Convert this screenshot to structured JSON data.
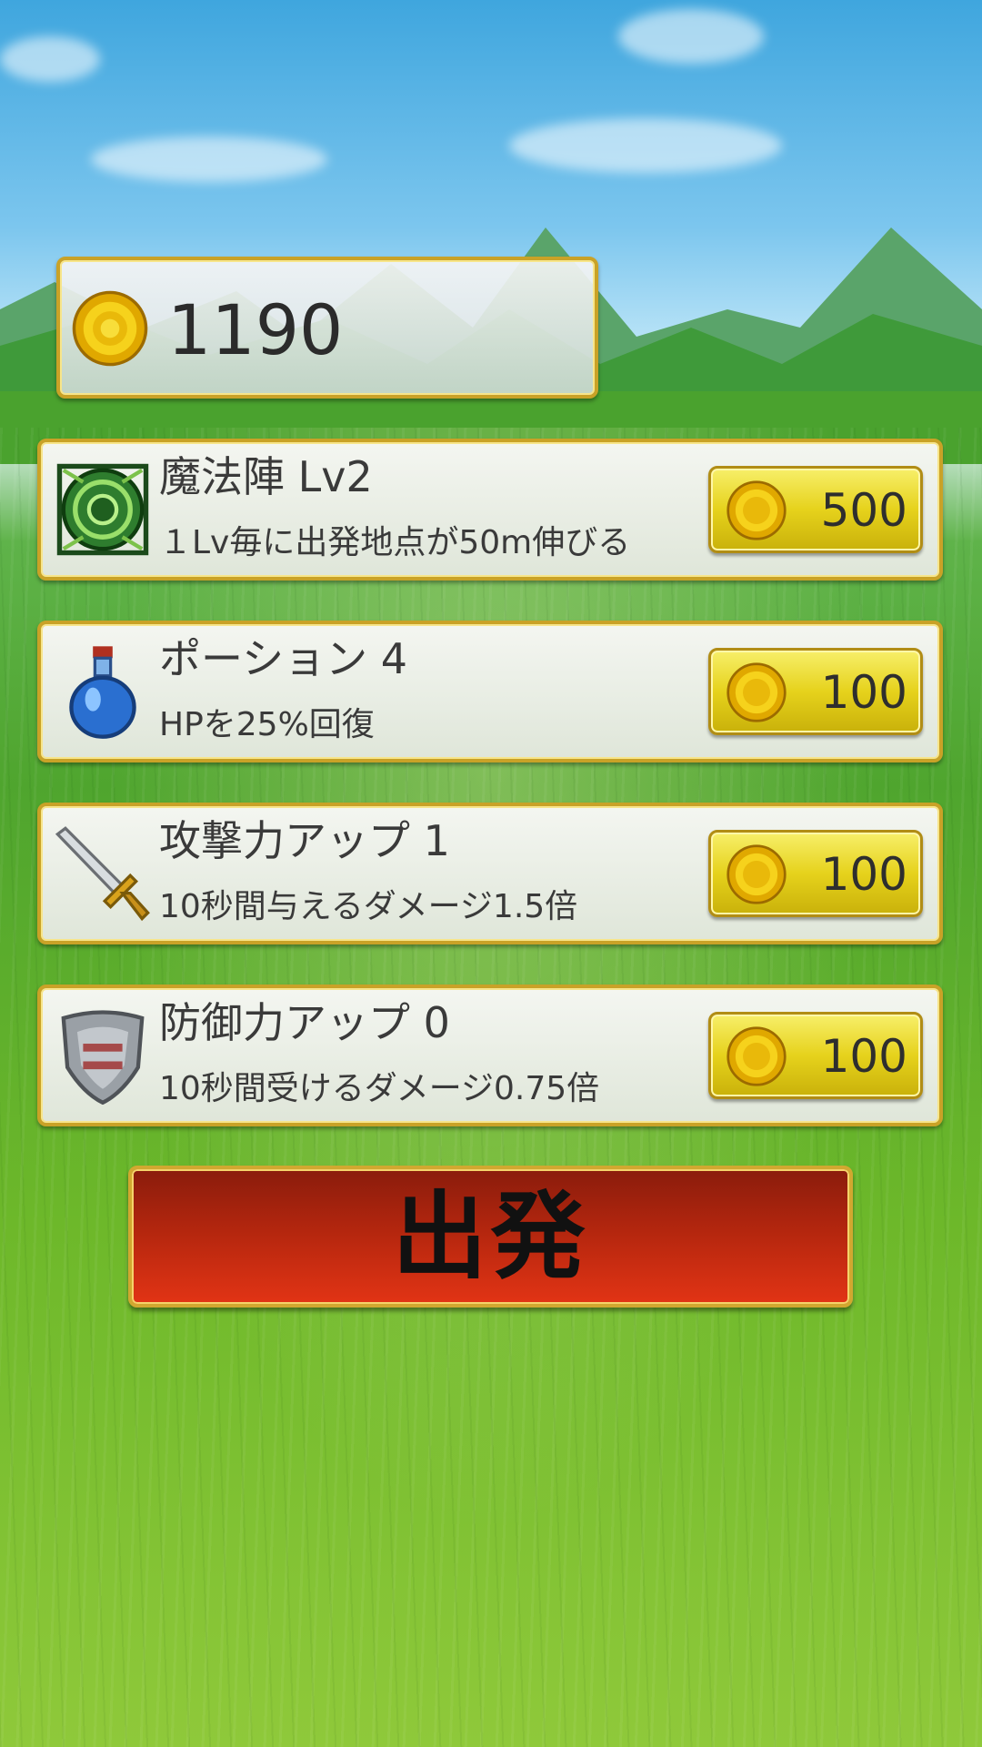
{
  "wallet": {
    "coins": "1190"
  },
  "items": [
    {
      "name": "魔法陣 Lv2",
      "desc": "１Lv毎に出発地点が50m伸びる",
      "price": "500",
      "icon": "magic-circle-icon"
    },
    {
      "name": "ポーション 4",
      "desc": "HPを25%回復",
      "price": "100",
      "icon": "potion-icon"
    },
    {
      "name": "攻撃力アップ 1",
      "desc": "10秒間与えるダメージ1.5倍",
      "price": "100",
      "icon": "sword-icon"
    },
    {
      "name": "防御力アップ 0",
      "desc": "10秒間受けるダメージ0.75倍",
      "price": "100",
      "icon": "shield-icon"
    }
  ],
  "depart": {
    "label": "出発"
  },
  "colors": {
    "panel_border": "#c9a227",
    "coin": "#f2c400",
    "depart_button": "#b3260e"
  }
}
